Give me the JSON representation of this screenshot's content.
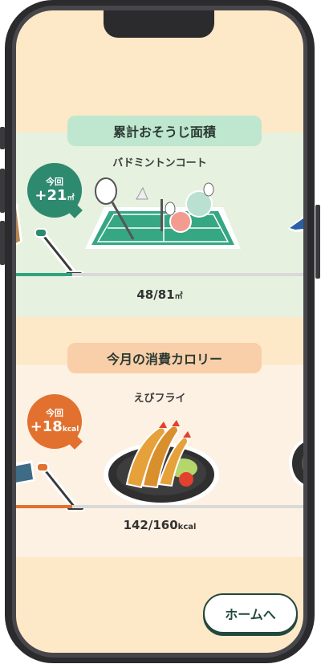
{
  "section_area": {
    "title": "累計おそうじ面積",
    "subtitle": "バドミントンコート",
    "bubble_label": "今回",
    "bubble_value": "+21",
    "bubble_unit": "㎡",
    "progress_current": "48",
    "progress_total": "81",
    "progress_unit": "㎡",
    "progress_fraction": 0.593,
    "color": "#2e8a6e"
  },
  "section_calorie": {
    "title": "今月の消費カロリー",
    "subtitle": "えびフライ",
    "bubble_label": "今回",
    "bubble_value": "+18",
    "bubble_unit": "kcal",
    "progress_current": "142",
    "progress_total": "160",
    "progress_unit": "kcal",
    "progress_fraction": 0.888,
    "color": "#e2712f"
  },
  "home_button": {
    "label": "ホームへ"
  },
  "icons": [
    "vacuum-cleaner-icon",
    "badminton-court-icon",
    "fried-shrimp-plate-icon",
    "box-icon"
  ]
}
